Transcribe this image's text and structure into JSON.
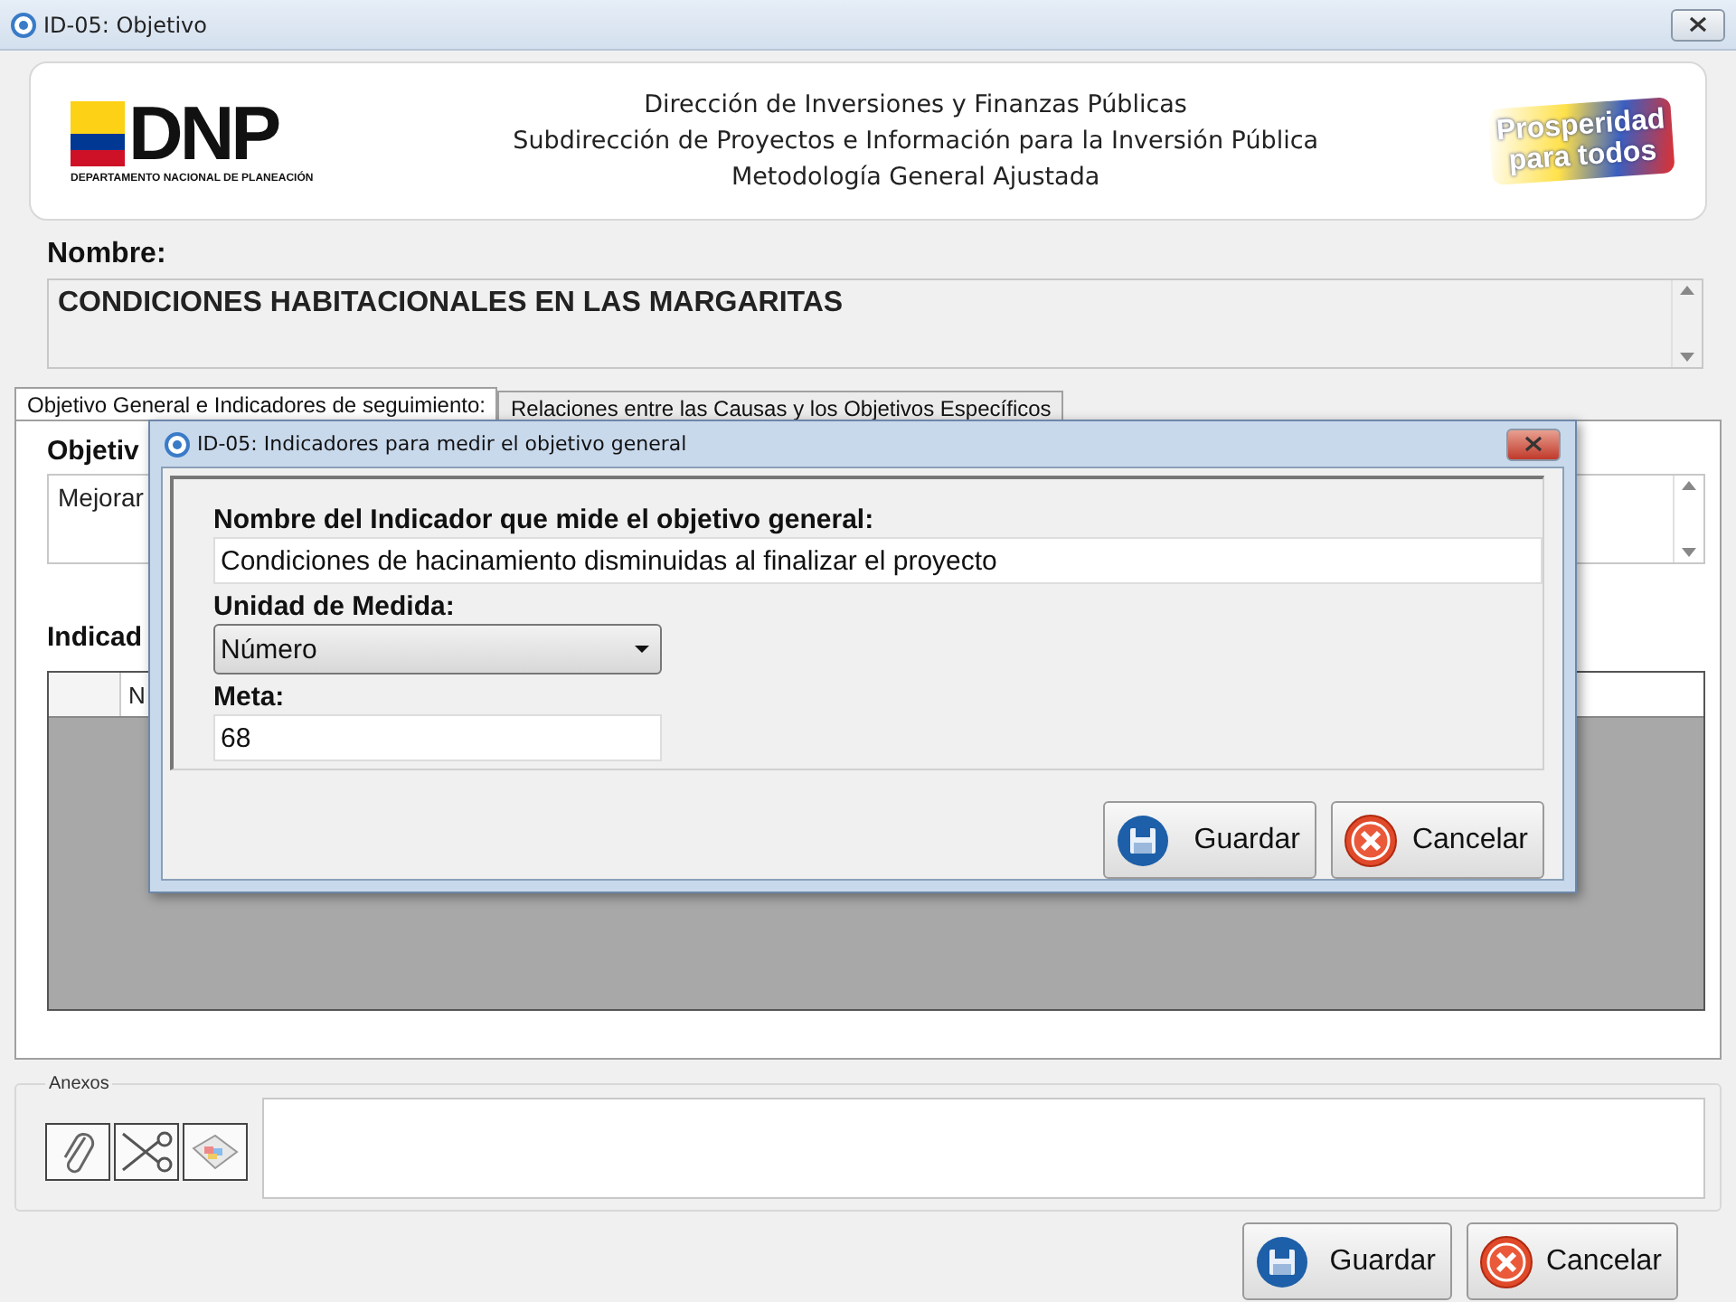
{
  "window": {
    "title": "ID-05: Objetivo"
  },
  "header": {
    "logo_text": "DNP",
    "logo_subtitle": "DEPARTAMENTO NACIONAL DE PLANEACIÓN",
    "lines": [
      "Dirección de Inversiones y Finanzas Públicas",
      "Subdirección de Proyectos e Información para la Inversión Pública",
      "Metodología General Ajustada"
    ],
    "slogan": [
      "Prosperidad",
      "para todos"
    ]
  },
  "nombre": {
    "label": "Nombre:",
    "value": "CONDICIONES HABITACIONALES EN LAS MARGARITAS"
  },
  "tabs": [
    {
      "label": "Objetivo General e Indicadores de seguimiento:",
      "selected": true
    },
    {
      "label": "Relaciones entre las Causas y los Objetivos Específicos",
      "selected": false
    }
  ],
  "panel": {
    "objective_label": "Objetiv",
    "objective_value": "Mejorar",
    "indicators_label": "Indicad",
    "grid_column": "N"
  },
  "anexos": {
    "title": "Anexos"
  },
  "buttons": [
    {
      "kind": "save",
      "label": "Guardar"
    },
    {
      "kind": "cancel",
      "label": "Cancelar"
    }
  ],
  "dialog": {
    "title": "ID-05: Indicadores para medir el objetivo general",
    "name_label": "Nombre del Indicador que mide el objetivo general:",
    "name_value": "Condiciones de hacinamiento disminuidas al finalizar el proyecto",
    "unit_label": "Unidad de Medida:",
    "unit_value": "Número",
    "goal_label": "Meta:",
    "goal_value": "68",
    "buttons": [
      {
        "kind": "save",
        "label": "Guardar"
      },
      {
        "kind": "cancel",
        "label": "Cancelar"
      }
    ]
  }
}
